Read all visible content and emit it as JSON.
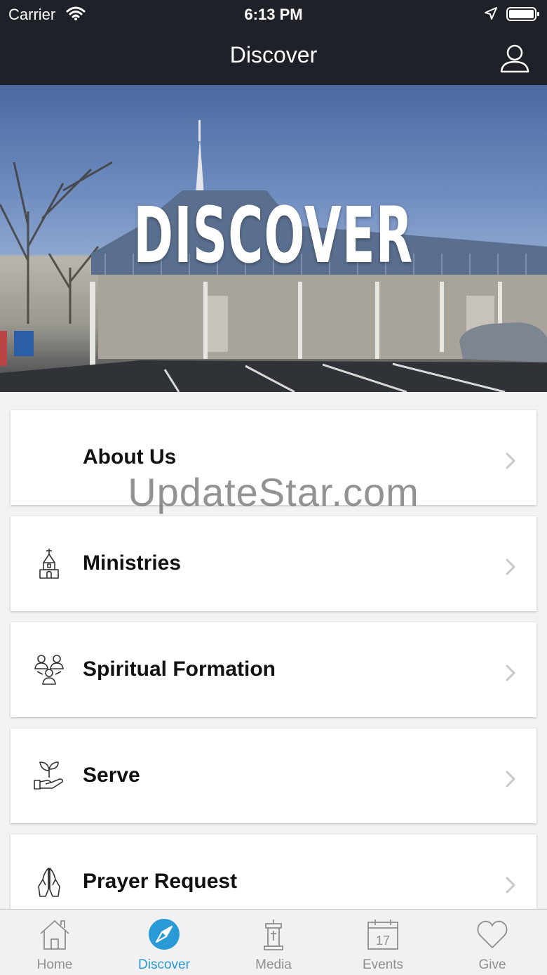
{
  "status_bar": {
    "carrier": "Carrier",
    "time": "6:13 PM"
  },
  "nav": {
    "title": "Discover",
    "profile_icon": "person-icon"
  },
  "hero": {
    "title": "DISCOVER"
  },
  "watermark": "UpdateStar.com",
  "menu": [
    {
      "label": "About Us",
      "icon": "none"
    },
    {
      "label": "Ministries",
      "icon": "church-icon"
    },
    {
      "label": "Spiritual Formation",
      "icon": "group-icon"
    },
    {
      "label": "Serve",
      "icon": "hand-plant-icon"
    },
    {
      "label": "Prayer Request",
      "icon": "praying-hands-icon"
    }
  ],
  "tabs": [
    {
      "label": "Home",
      "icon": "home-icon",
      "active": false
    },
    {
      "label": "Discover",
      "icon": "compass-icon",
      "active": true
    },
    {
      "label": "Media",
      "icon": "pulpit-icon",
      "active": false
    },
    {
      "label": "Events",
      "icon": "calendar-icon",
      "active": false,
      "date": "17"
    },
    {
      "label": "Give",
      "icon": "heart-icon",
      "active": false
    }
  ],
  "colors": {
    "bar": "#1e2128",
    "accent": "#2a9ad6",
    "tab_inactive": "#8e8e93"
  }
}
